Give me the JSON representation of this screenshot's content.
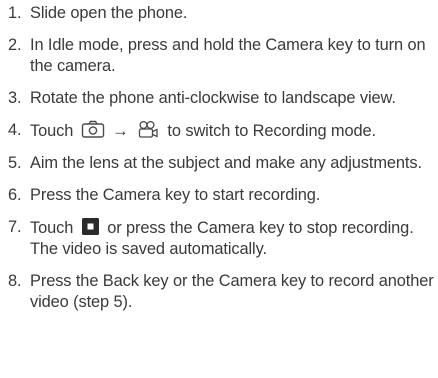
{
  "steps": [
    {
      "number": "1.",
      "text": "Slide open the phone."
    },
    {
      "number": "2.",
      "text": "In Idle mode, press and hold the Camera key to turn on the camera."
    },
    {
      "number": "3.",
      "text": "Rotate the phone anti-clockwise to landscape view."
    },
    {
      "number": "4.",
      "text_before": "Touch",
      "arrow": "→",
      "text_after": "to switch to Recording mode.",
      "icons": [
        "camera-icon",
        "video-camera-icon"
      ]
    },
    {
      "number": "5.",
      "text": "Aim the lens at the subject and make any adjustments."
    },
    {
      "number": "6.",
      "text": "Press the Camera key to start recording."
    },
    {
      "number": "7.",
      "text_before": "Touch",
      "text_after": "or press the Camera key to stop recording.",
      "note": "The video is saved automatically.",
      "icons": [
        "stop-icon"
      ]
    },
    {
      "number": "8.",
      "text": "Press the Back key or the Camera key to record another video (step 5)."
    }
  ]
}
